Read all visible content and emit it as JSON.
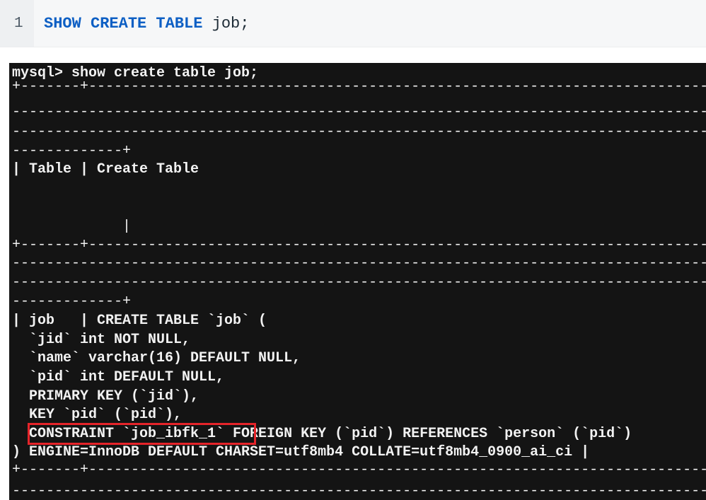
{
  "editor": {
    "line_number": "1",
    "keyword": "SHOW CREATE TABLE",
    "statement_rest": " job;"
  },
  "terminal": {
    "prompt_command": "mysql> show create table job;",
    "lines": [
      "+-------+-----------------------------------------------------------------------------------",
      "------------------------------------------------------------------------------------------",
      "------------------------------------------------------------------------------------------",
      "-------------+",
      "| Table | Create Table",
      "",
      "",
      "             |",
      "+-------+-----------------------------------------------------------------------------------",
      "------------------------------------------------------------------------------------------",
      "------------------------------------------------------------------------------------------",
      "-------------+",
      "| job   | CREATE TABLE `job` (",
      "  `jid` int NOT NULL,",
      "  `name` varchar(16) DEFAULT NULL,",
      "  `pid` int DEFAULT NULL,",
      "  PRIMARY KEY (`jid`),",
      "  KEY `pid` (`pid`),",
      "  CONSTRAINT `job_ibfk_1` FOREIGN KEY (`pid`) REFERENCES `person` (`pid`)",
      ") ENGINE=InnoDB DEFAULT CHARSET=utf8mb4 COLLATE=utf8mb4_0900_ai_ci |",
      "+-------+-----------------------------------------------------------------------------------",
      "------------------------------------------------------------------------------------------"
    ]
  }
}
